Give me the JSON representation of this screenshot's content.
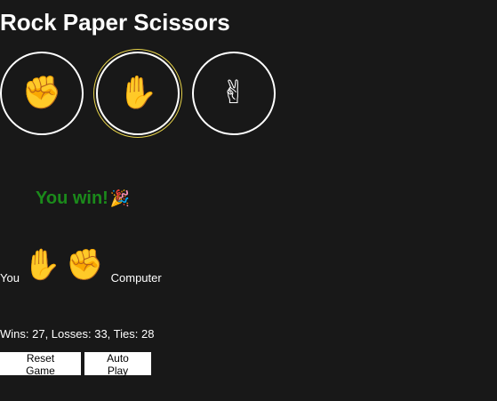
{
  "title": "Rock Paper Scissors",
  "moves": {
    "rock": {
      "icon": "fist-icon",
      "glyph": "✊"
    },
    "paper": {
      "icon": "raised-hand-icon",
      "glyph": "✋"
    },
    "scissors": {
      "icon": "victory-hand-icon",
      "glyph": "✌"
    },
    "selected": "paper"
  },
  "result": {
    "text": "You win!",
    "icon": "party-popper-icon",
    "glyph": "🎉"
  },
  "played": {
    "you_label": "You",
    "you_move_glyph": "✋",
    "computer_move_glyph": "✊",
    "computer_label": "Computer"
  },
  "score": {
    "text": "Wins: 27, Losses: 33, Ties: 28"
  },
  "buttons": {
    "reset": "Reset Game",
    "auto": "Auto Play"
  },
  "colors": {
    "background": "#181818",
    "win_text": "#1b8a1b",
    "selected_ring": "#e8d44a"
  }
}
